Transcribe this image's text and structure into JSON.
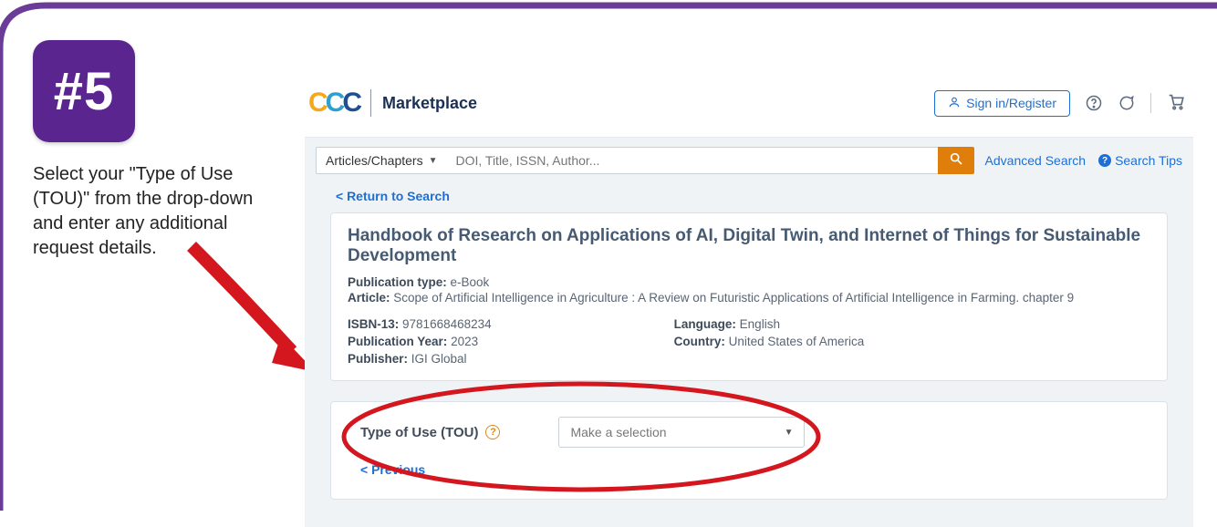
{
  "step": {
    "badge": "#5",
    "instruction": "Select your \"Type of Use (TOU)\" from the drop-down and enter any additional request details."
  },
  "brand": {
    "mark_letter": "C",
    "title": "Marketplace"
  },
  "topbar": {
    "signin_label": "Sign in/Register"
  },
  "search": {
    "dropdown_label": "Articles/Chapters",
    "placeholder": "DOI, Title, ISSN, Author...",
    "advanced_label": "Advanced Search",
    "tips_label": "Search Tips"
  },
  "nav": {
    "return_label": "<  Return to Search"
  },
  "publication": {
    "title": "Handbook of Research on Applications of AI, Digital Twin, and Internet of Things for Sustainable Development",
    "meta": {
      "publication_type_label": "Publication type:",
      "publication_type_value": "e-Book",
      "article_label": "Article:",
      "article_value": "Scope of Artificial Intelligence in Agriculture : A Review on Futuristic Applications of Artificial Intelligence in Farming. chapter 9",
      "isbn13_label": "ISBN-13:",
      "isbn13_value": "9781668468234",
      "pubyear_label": "Publication Year:",
      "pubyear_value": "2023",
      "publisher_label": "Publisher:",
      "publisher_value": "IGI Global",
      "language_label": "Language:",
      "language_value": "English",
      "country_label": "Country:",
      "country_value": "United States of America"
    }
  },
  "tou": {
    "label": "Type of Use (TOU)",
    "select_placeholder": "Make a selection",
    "previous_label": "<  Previous"
  }
}
